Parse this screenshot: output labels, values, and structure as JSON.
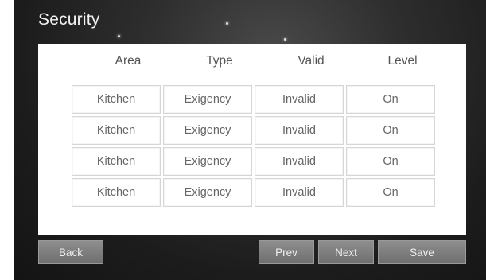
{
  "title": "Security",
  "columns": [
    "Area",
    "Type",
    "Valid",
    "Level"
  ],
  "rows": [
    {
      "area": "Kitchen",
      "type": "Exigency",
      "valid": "Invalid",
      "level": "On"
    },
    {
      "area": "Kitchen",
      "type": "Exigency",
      "valid": "Invalid",
      "level": "On"
    },
    {
      "area": "Kitchen",
      "type": "Exigency",
      "valid": "Invalid",
      "level": "On"
    },
    {
      "area": "Kitchen",
      "type": "Exigency",
      "valid": "Invalid",
      "level": "On"
    }
  ],
  "buttons": {
    "back": "Back",
    "prev": "Prev",
    "next": "Next",
    "save": "Save"
  }
}
